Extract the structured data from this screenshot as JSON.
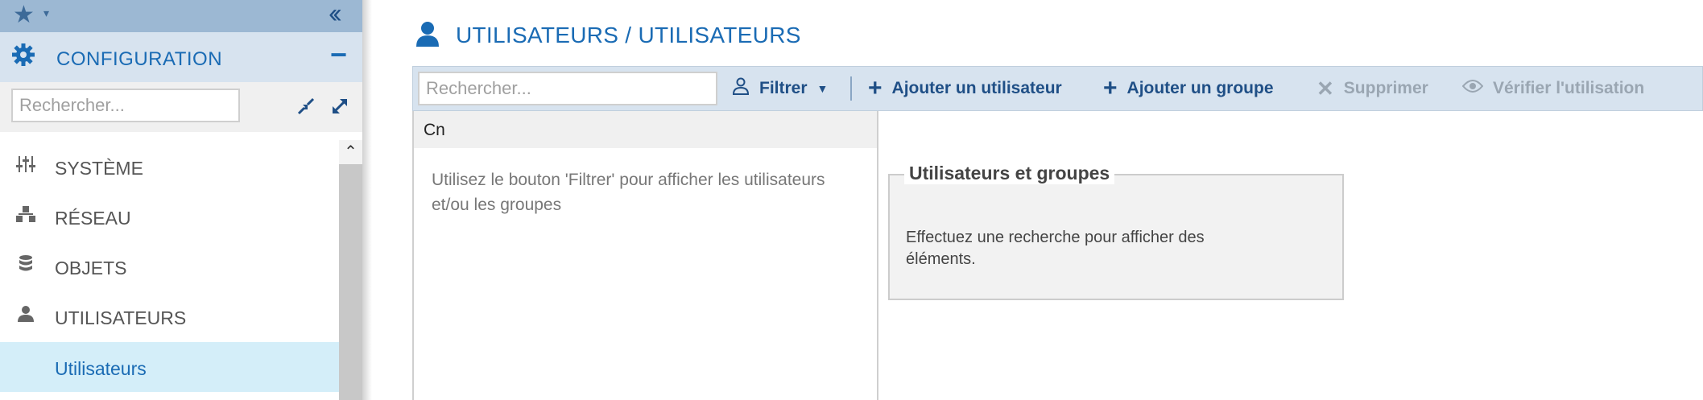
{
  "sidebar": {
    "config_label": "CONFIGURATION",
    "search_placeholder": "Rechercher...",
    "items": [
      {
        "label": "SYSTÈME",
        "icon": "sliders-icon"
      },
      {
        "label": "RÉSEAU",
        "icon": "network-icon"
      },
      {
        "label": "OBJETS",
        "icon": "database-icon"
      },
      {
        "label": "UTILISATEURS",
        "icon": "user-icon"
      },
      {
        "label": "Utilisateurs",
        "icon": "",
        "active": true
      }
    ]
  },
  "main": {
    "title": "UTILISATEURS / UTILISATEURS",
    "toolbar": {
      "search_placeholder": "Rechercher...",
      "filter_label": "Filtrer",
      "add_user_label": "Ajouter un utilisateur",
      "add_group_label": "Ajouter un groupe",
      "delete_label": "Supprimer",
      "check_usage_label": "Vérifier l'utilisation"
    },
    "list": {
      "column_header": "Cn",
      "hint": "Utilisez le bouton 'Filtrer' pour afficher les utilisateurs et/ou les groupes"
    },
    "groupbox": {
      "legend": "Utilisateurs et groupes",
      "message": "Effectuez une recherche pour afficher des éléments."
    }
  },
  "colors": {
    "accent": "#1a6bb4",
    "toolbar_bg": "#d7e3ef",
    "active_item_bg": "#d4eef9",
    "sidebar_top_bg": "#9cb8d3"
  }
}
